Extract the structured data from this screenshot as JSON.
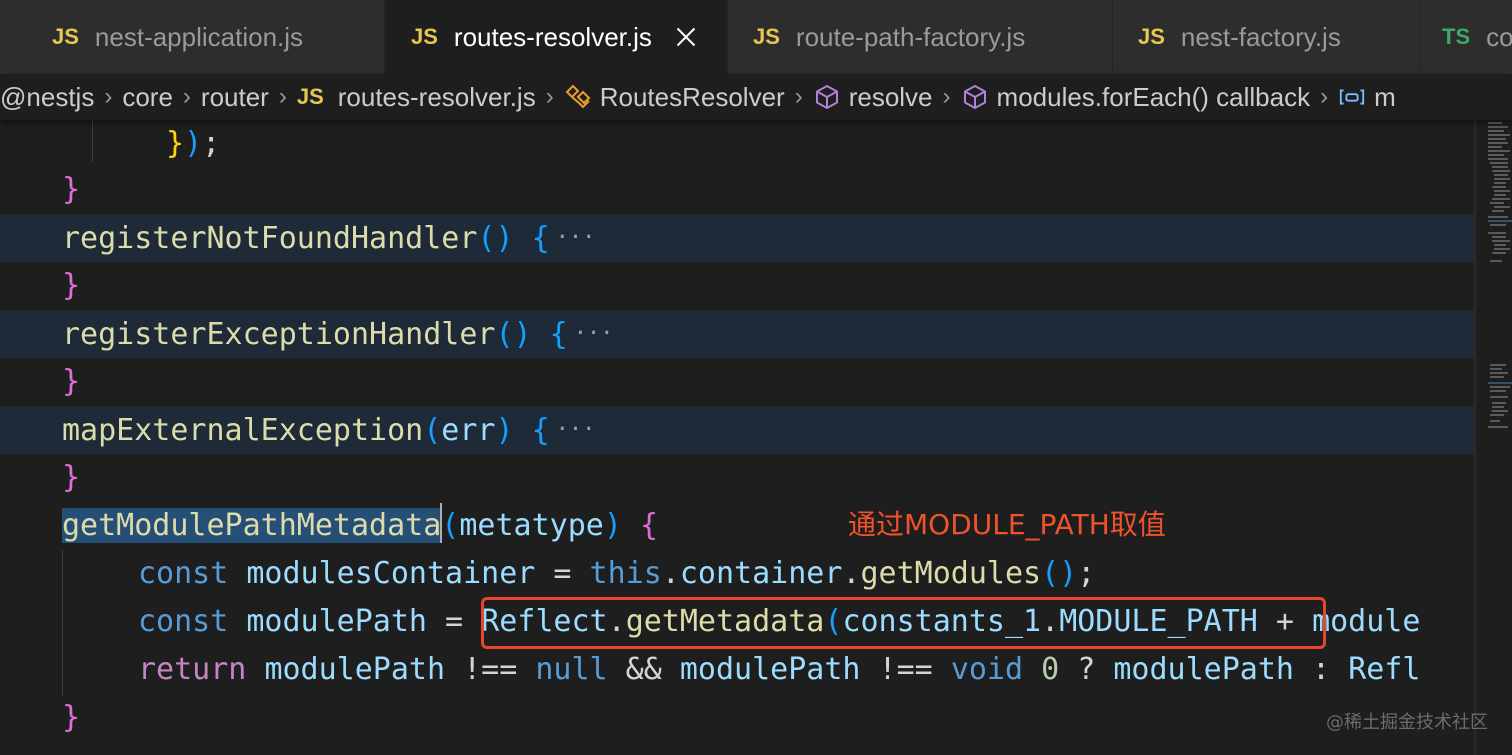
{
  "tabs": [
    {
      "type": "JS",
      "name": "nest-application.js",
      "active": false
    },
    {
      "type": "JS",
      "name": "routes-resolver.js",
      "active": true
    },
    {
      "type": "JS",
      "name": "route-path-factory.js",
      "active": false
    },
    {
      "type": "JS",
      "name": "nest-factory.js",
      "active": false
    },
    {
      "type": "TS",
      "name": "co",
      "active": false
    }
  ],
  "breadcrumb": {
    "items": [
      "@nestjs",
      "core",
      "router"
    ],
    "file_type": "JS",
    "file": "routes-resolver.js",
    "class_name": "RoutesResolver",
    "method": "resolve",
    "callback": "modules.forEach() callback",
    "last": "m"
  },
  "code": {
    "closing_paren": "});",
    "brace_close": "}",
    "fold_ellipsis": "···",
    "m1_name": "registerNotFoundHandler",
    "m2_name": "registerExceptionHandler",
    "m3_name": "mapExternalException",
    "m3_param": "err",
    "m4_name": "getModulePathMetadata",
    "m4_param": "metatype",
    "kw_const": "const",
    "kw_this": "this",
    "kw_return": "return",
    "kw_null": "null",
    "kw_void": "void",
    "v_modules_container": "modulesContainer",
    "v_container": "container",
    "v_get_modules": "getModules",
    "v_module_path": "modulePath",
    "v_reflect": "Reflect",
    "v_get_metadata": "getMetadata",
    "v_constants": "constants_1",
    "v_module_path_const": "MODULE_PATH",
    "v_module_tail": "module",
    "v_refl": "Refl",
    "num_zero": "0"
  },
  "annotation": {
    "label": "通过MODULE_PATH取值",
    "color": "#e8452e"
  },
  "watermark": "@稀土掘金技术社区",
  "colors": {
    "editor_bg": "#1e1e1e",
    "function": "#dcdcaa",
    "keyword": "#569cd6",
    "variable": "#9cdcfe",
    "js_icon": "#e6c84f",
    "ts_icon": "#3ea86b"
  }
}
